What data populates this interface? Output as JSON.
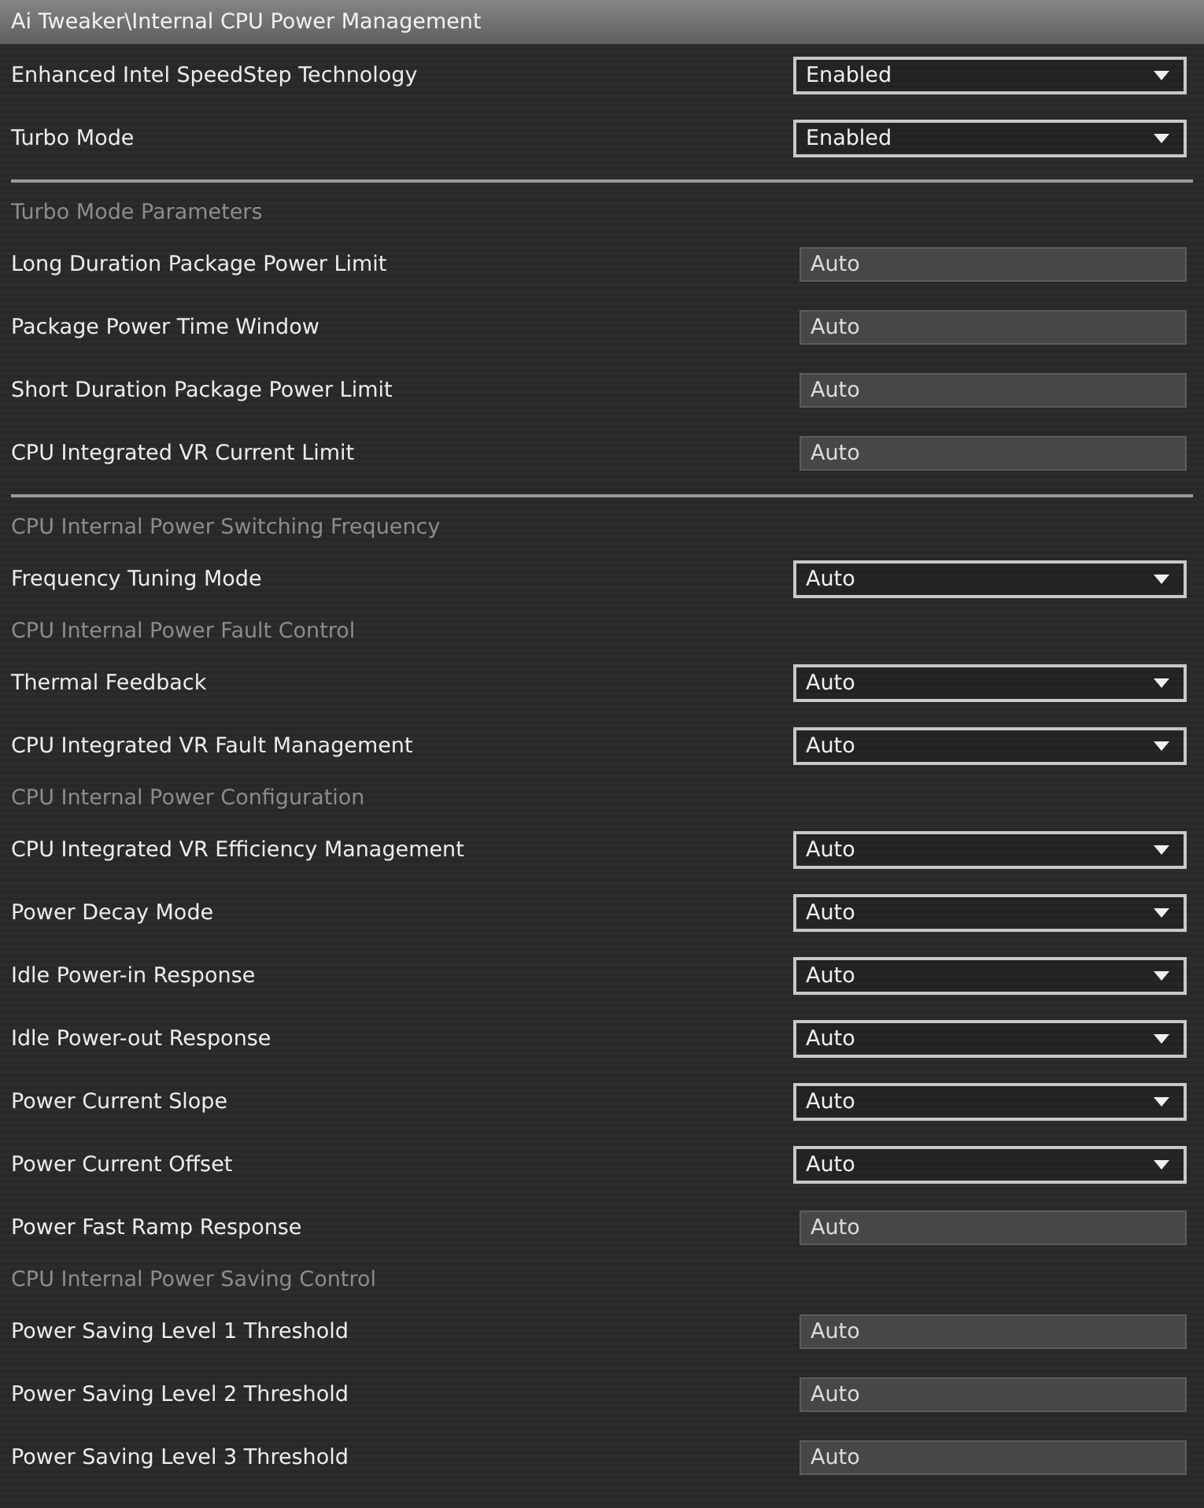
{
  "title": "Ai Tweaker\\Internal CPU Power Management",
  "items": [
    {
      "kind": "select",
      "label": "Enhanced Intel SpeedStep Technology",
      "value": "Enabled"
    },
    {
      "kind": "select",
      "label": "Turbo Mode",
      "value": "Enabled"
    },
    {
      "kind": "divider"
    },
    {
      "kind": "heading",
      "label": "Turbo Mode Parameters"
    },
    {
      "kind": "field",
      "label": "Long Duration Package Power Limit",
      "value": "Auto"
    },
    {
      "kind": "field",
      "label": "Package Power Time Window",
      "value": "Auto"
    },
    {
      "kind": "field",
      "label": "Short Duration Package Power Limit",
      "value": "Auto"
    },
    {
      "kind": "field",
      "label": "CPU Integrated VR Current Limit",
      "value": "Auto"
    },
    {
      "kind": "divider"
    },
    {
      "kind": "heading",
      "label": "CPU Internal Power Switching Frequency"
    },
    {
      "kind": "select",
      "label": "Frequency Tuning Mode",
      "value": "Auto"
    },
    {
      "kind": "heading",
      "label": "CPU Internal Power Fault Control"
    },
    {
      "kind": "select",
      "label": "Thermal Feedback",
      "value": "Auto"
    },
    {
      "kind": "select",
      "label": "CPU Integrated VR Fault Management",
      "value": "Auto"
    },
    {
      "kind": "heading",
      "label": "CPU Internal Power Configuration"
    },
    {
      "kind": "select",
      "label": "CPU Integrated VR Efficiency Management",
      "value": "Auto"
    },
    {
      "kind": "select",
      "label": "Power Decay Mode",
      "value": "Auto"
    },
    {
      "kind": "select",
      "label": "Idle Power-in Response",
      "value": "Auto"
    },
    {
      "kind": "select",
      "label": "Idle Power-out Response",
      "value": "Auto"
    },
    {
      "kind": "select",
      "label": "Power Current Slope",
      "value": "Auto"
    },
    {
      "kind": "select",
      "label": "Power Current Offset",
      "value": "Auto"
    },
    {
      "kind": "field",
      "label": "Power Fast Ramp Response",
      "value": "Auto"
    },
    {
      "kind": "heading",
      "label": "CPU Internal Power Saving Control"
    },
    {
      "kind": "field",
      "label": "Power Saving Level 1 Threshold",
      "value": "Auto"
    },
    {
      "kind": "field",
      "label": "Power Saving Level 2 Threshold",
      "value": "Auto"
    },
    {
      "kind": "field",
      "label": "Power Saving Level 3 Threshold",
      "value": "Auto"
    }
  ]
}
